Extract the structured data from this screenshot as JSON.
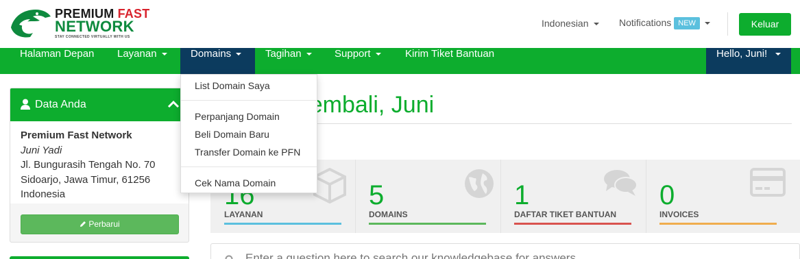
{
  "brand": {
    "line1_a": "PREMIUM",
    "line1_b": "FAST",
    "line2": "NETWORK",
    "tagline": "STAY CONNECTED VIRTUALLY WITH US",
    "colors": {
      "primary": "#0dad2e",
      "dark": "#0c3b5e",
      "fast_red": "#d9232d"
    }
  },
  "header": {
    "language": "Indonesian",
    "notifications": "Notifications",
    "notifications_badge": "NEW",
    "logout": "Keluar"
  },
  "navbar": {
    "items": [
      {
        "label": "Halaman Depan"
      },
      {
        "label": "Layanan"
      },
      {
        "label": "Domains"
      },
      {
        "label": "Tagihan"
      },
      {
        "label": "Support"
      },
      {
        "label": "Kirim Tiket Bantuan"
      }
    ],
    "hello": "Hello, Juni!"
  },
  "domains_dropdown": {
    "items": [
      {
        "label": "List Domain Saya"
      },
      {
        "label": "Perpanjang Domain"
      },
      {
        "label": "Beli Domain Baru"
      },
      {
        "label": "Transfer Domain ke PFN"
      },
      {
        "label": "Cek Nama Domain"
      }
    ]
  },
  "sidebar": {
    "panel_title": "Data Anda",
    "company": "Premium Fast Network",
    "person": "Juni Yadi",
    "address1": "Jl. Bungurasih Tengah No. 70",
    "address2": "Sidoarjo, Jawa Timur, 61256",
    "country": "Indonesia",
    "update_button": "Perbarui"
  },
  "main": {
    "welcome": "Datang Kembali, Juni",
    "search_placeholder": "Enter a question here to search our knowledgebase for answers...",
    "tiles": [
      {
        "number": "16",
        "label": "LAYANAN",
        "icon": "cube-icon",
        "bar_color": "#5bc0de"
      },
      {
        "number": "5",
        "label": "DOMAINS",
        "icon": "globe-icon",
        "bar_color": "#5cb85c"
      },
      {
        "number": "1",
        "label": "DAFTAR TIKET BANTUAN",
        "icon": "comments-icon",
        "bar_color": "#d9534f"
      },
      {
        "number": "0",
        "label": "INVOICES",
        "icon": "credit-card-icon",
        "bar_color": "#f0ad4e"
      }
    ]
  }
}
